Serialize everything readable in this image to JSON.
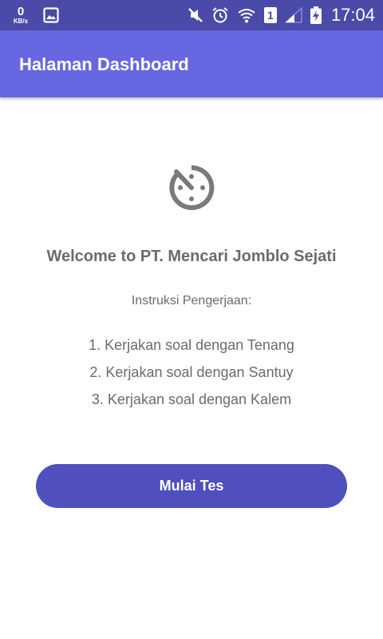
{
  "status_bar": {
    "data_rate_value": "0",
    "data_rate_unit": "KB/s",
    "sim_slot": "1",
    "time": "17:04",
    "icons": [
      "gallery-icon",
      "mute-icon",
      "alarm-icon",
      "wifi-icon",
      "sim-icon",
      "signal-icon",
      "battery-charging-icon"
    ]
  },
  "app_bar": {
    "title": "Halaman Dashboard"
  },
  "main": {
    "icon": "timer-icon",
    "welcome": "Welcome to PT. Mencari Jomblo Sejati",
    "instructions_title": "Instruksi Pengerjaan:",
    "instructions": [
      "1. Kerjakan soal dengan Tenang",
      "2. Kerjakan soal dengan Santuy",
      "3. Kerjakan soal dengan Kalem"
    ],
    "start_button_label": "Mulai Tes"
  },
  "colors": {
    "status_bar": "#4a4aa8",
    "app_bar": "#6767e1",
    "button": "#4f4fbd",
    "text_gray": "#6b6b6b"
  }
}
